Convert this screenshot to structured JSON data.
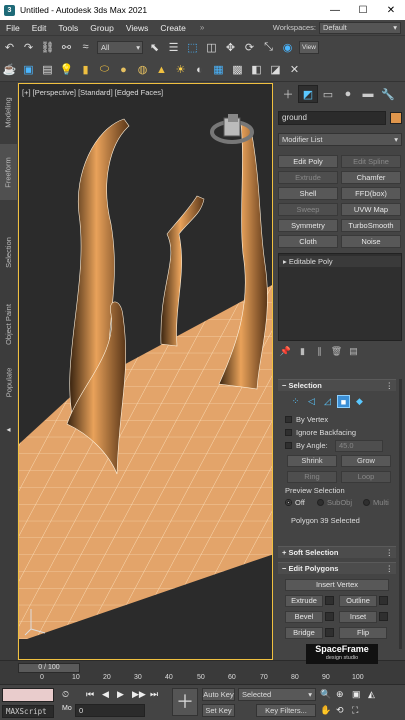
{
  "window": {
    "title": "Untitled - Autodesk 3ds Max 2021",
    "minimize": "—",
    "maximize": "☐",
    "close": "✕"
  },
  "menu": {
    "items": [
      "File",
      "Edit",
      "Tools",
      "Group",
      "Views",
      "Create"
    ],
    "workspaces_label": "Workspaces:",
    "workspace_value": "Default"
  },
  "toolbar": {
    "selection_filter": "All",
    "view_button": "View"
  },
  "side_tabs": [
    "Modeling",
    "Freeform",
    "Selection",
    "Object Paint",
    "Populate"
  ],
  "viewport": {
    "label": "[+] [Perspective] [Standard] [Edged Faces]"
  },
  "command_panel": {
    "object_name": "ground",
    "object_color": "#e0964c",
    "modifier_list": "Modifier List",
    "modifier_buttons": [
      "Edit Poly",
      "Edit Spline",
      "Extrude",
      "Chamfer",
      "Shell",
      "FFD(box)",
      "Sweep",
      "UVW Map",
      "Symmetry",
      "TurboSmooth",
      "Cloth",
      "Noise"
    ],
    "modifier_buttons_dimmed": [
      "Edit Spline",
      "Extrude",
      "Sweep"
    ],
    "stack_item": "Editable Poly",
    "selection_rollout": {
      "title": "Selection",
      "by_vertex": "By Vertex",
      "ignore_backfacing": "Ignore Backfacing",
      "by_angle": "By Angle:",
      "angle_value": "45.0",
      "shrink": "Shrink",
      "grow": "Grow",
      "ring": "Ring",
      "loop": "Loop",
      "preview_label": "Preview Selection",
      "preview_options": [
        "Off",
        "SubObj",
        "Multi"
      ],
      "status": "Polygon 39 Selected"
    },
    "soft_selection": "Soft Selection",
    "edit_polygons": {
      "title": "Edit Polygons",
      "insert_vertex": "Insert Vertex",
      "extrude": "Extrude",
      "outline": "Outline",
      "bevel": "Bevel",
      "inset": "Inset",
      "bridge": "Bridge",
      "flip": "Flip"
    }
  },
  "timeline": {
    "slider_label": "0 / 100",
    "ticks": [
      "0",
      "10",
      "20",
      "30",
      "40",
      "50",
      "60",
      "70",
      "80",
      "90",
      "100"
    ]
  },
  "bottom": {
    "maxscript": "MAXScript",
    "mode_short": "Mo",
    "frame_value": "0",
    "auto_key": "Auto Key",
    "set_key": "Set Key",
    "selected": "Selected",
    "key_filters": "Key Filters..."
  },
  "branding": {
    "name": "SpaceFrame",
    "tagline": "design studio"
  }
}
